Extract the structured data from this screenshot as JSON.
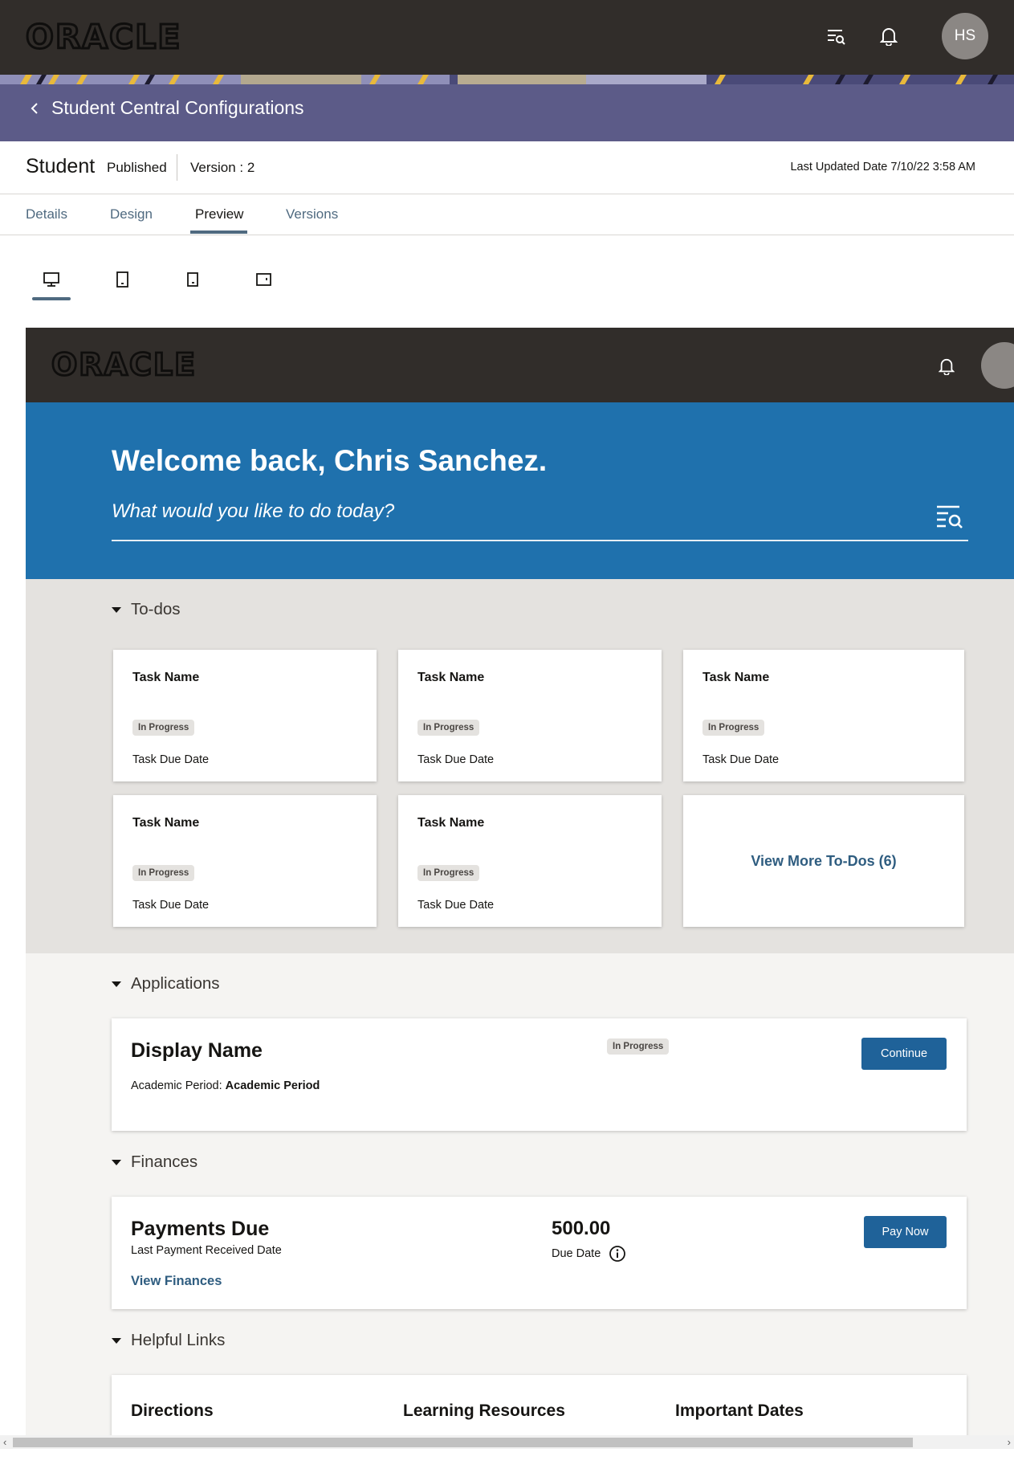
{
  "app": {
    "logo": "ORACLE",
    "avatar_initials": "HS",
    "icons": {
      "search": "search-list-icon",
      "notifications": "bell-icon"
    }
  },
  "banner": {
    "back_label": "Student Central Configurations"
  },
  "header": {
    "title": "Student",
    "status": "Published",
    "version": "Version : 2",
    "last_updated": "Last Updated Date  7/10/22 3:58 AM"
  },
  "tabs": [
    {
      "label": "Details",
      "active": false
    },
    {
      "label": "Design",
      "active": false
    },
    {
      "label": "Preview",
      "active": true
    },
    {
      "label": "Versions",
      "active": false
    }
  ],
  "devices": [
    {
      "name": "desktop",
      "active": true
    },
    {
      "name": "tablet-portrait",
      "active": false
    },
    {
      "name": "phone",
      "active": false
    },
    {
      "name": "tablet-landscape",
      "active": false
    }
  ],
  "preview": {
    "logo": "ORACLE",
    "welcome_title": "Welcome back, Chris Sanchez.",
    "search_prompt": "What would you like to do today?",
    "todos": {
      "heading": "To-dos",
      "tasks": [
        {
          "name": "Task Name",
          "status": "In Progress",
          "due": "Task Due Date"
        },
        {
          "name": "Task Name",
          "status": "In Progress",
          "due": "Task Due Date"
        },
        {
          "name": "Task Name",
          "status": "In Progress",
          "due": "Task Due Date"
        },
        {
          "name": "Task Name",
          "status": "In Progress",
          "due": "Task Due Date"
        },
        {
          "name": "Task Name",
          "status": "In Progress",
          "due": "Task Due Date"
        }
      ],
      "view_more": "View More To-Dos (6)"
    },
    "applications": {
      "heading": "Applications",
      "display_name": "Display Name",
      "period_label": "Academic Period:",
      "period_value": "Academic Period",
      "status": "In Progress",
      "button": "Continue"
    },
    "finances": {
      "heading": "Finances",
      "title": "Payments Due",
      "last_payment": "Last Payment Received Date",
      "view_link": "View Finances",
      "amount": "500.00",
      "due_label": "Due Date",
      "button": "Pay Now"
    },
    "helpful_links": {
      "heading": "Helpful Links",
      "links": [
        "Directions",
        "Learning Resources",
        "Important Dates"
      ]
    }
  },
  "colors": {
    "topbar": "#312d2a",
    "banner": "#5c5b88",
    "welcome": "#1f71ad",
    "button": "#1f6299",
    "link": "#2f5d80",
    "todo_bg": "#e4e2df"
  }
}
